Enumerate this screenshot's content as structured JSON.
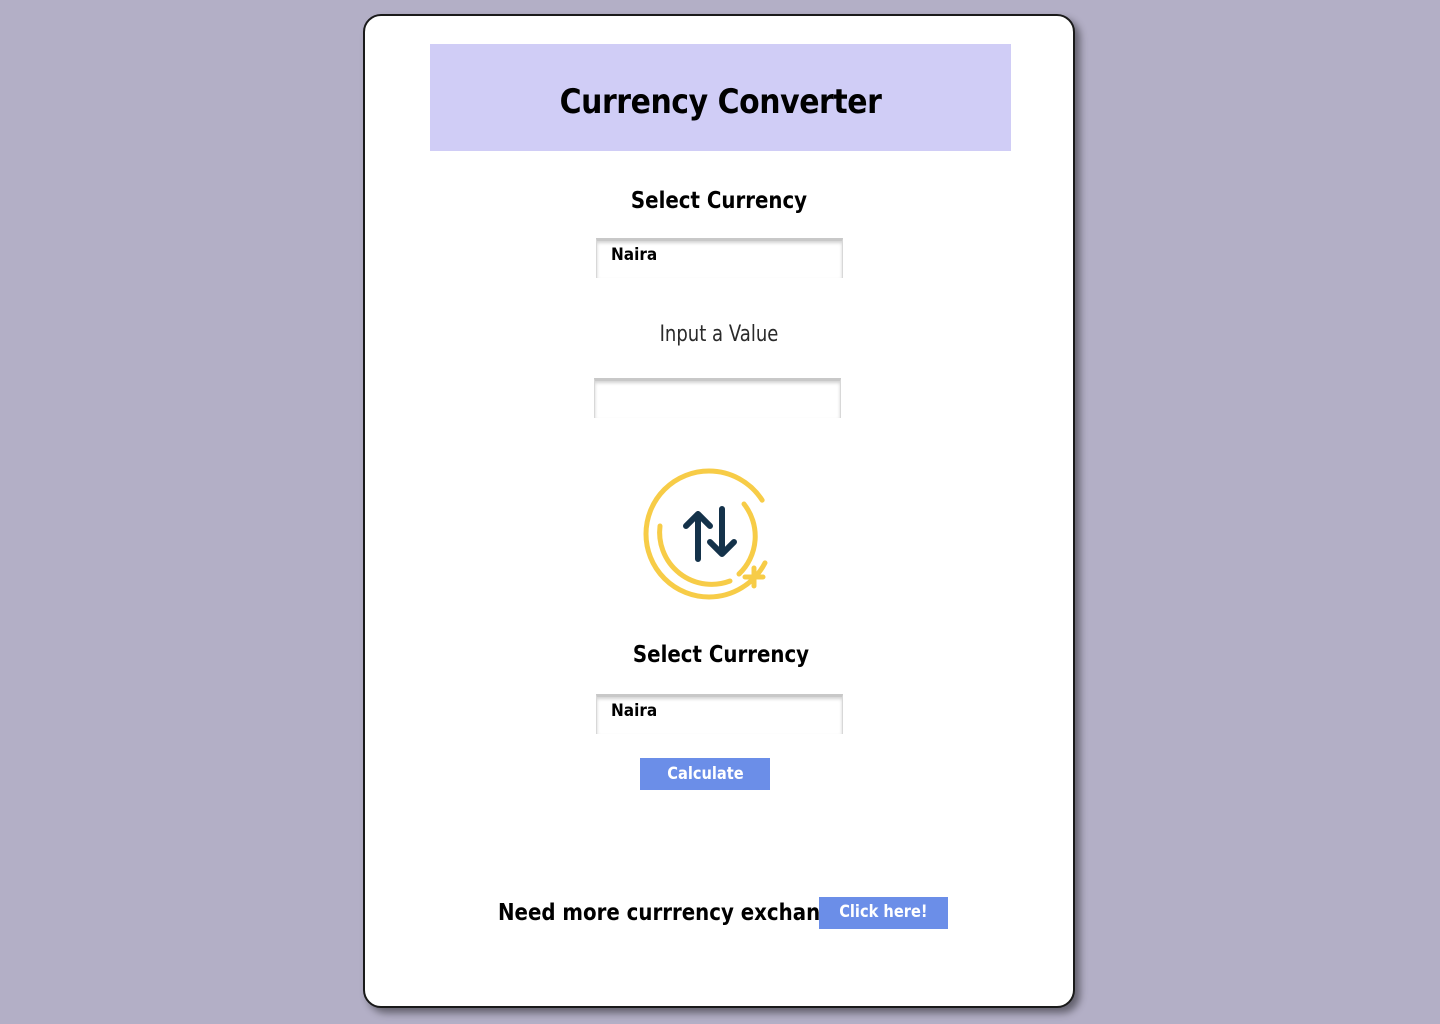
{
  "header": {
    "title": "Currency Converter"
  },
  "from": {
    "label": "Select Currency",
    "selected": "Naira"
  },
  "amount": {
    "label": "Input a Value",
    "value": ""
  },
  "to": {
    "label": "Select Currency",
    "selected": "Naira"
  },
  "actions": {
    "calculate_label": "Calculate"
  },
  "footer": {
    "question": "Need more currrency exchanges?",
    "link_label": "Click here!"
  },
  "colors": {
    "background": "#b3afc6",
    "header_band": "#d0cdf6",
    "button": "#6b8ee8",
    "icon_ring": "#f7cc47",
    "icon_arrows": "#14324a"
  },
  "icons": {
    "swap": "swap-arrows-icon"
  }
}
